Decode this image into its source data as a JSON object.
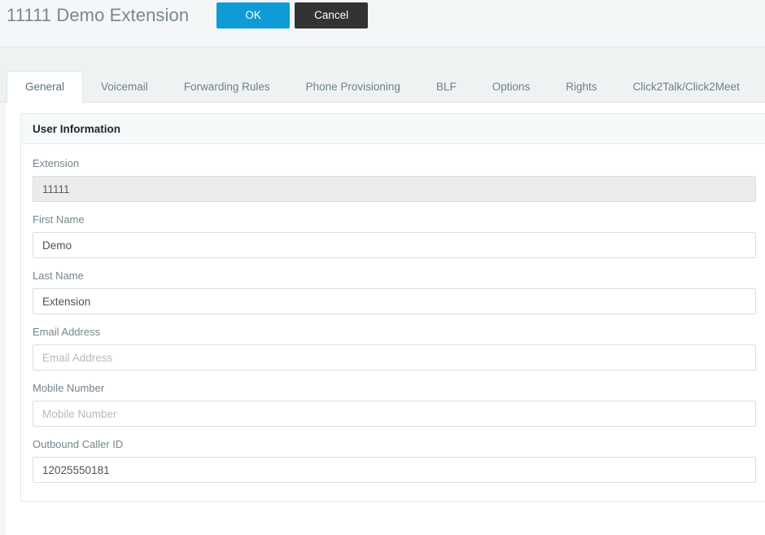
{
  "header": {
    "title": "11111 Demo Extension",
    "ok_label": "OK",
    "cancel_label": "Cancel",
    "ok_color": "#0e9bd6",
    "cancel_color": "#333333"
  },
  "tabs": [
    {
      "label": "General",
      "active": true
    },
    {
      "label": "Voicemail",
      "active": false
    },
    {
      "label": "Forwarding Rules",
      "active": false
    },
    {
      "label": "Phone Provisioning",
      "active": false
    },
    {
      "label": "BLF",
      "active": false
    },
    {
      "label": "Options",
      "active": false
    },
    {
      "label": "Rights",
      "active": false
    },
    {
      "label": "Click2Talk/Click2Meet",
      "active": false
    }
  ],
  "panel": {
    "title": "User Information",
    "fields": [
      {
        "label": "Extension",
        "value": "11111",
        "placeholder": "",
        "disabled": true,
        "name": "extension"
      },
      {
        "label": "First Name",
        "value": "Demo",
        "placeholder": "First Name",
        "disabled": false,
        "name": "first-name"
      },
      {
        "label": "Last Name",
        "value": "Extension",
        "placeholder": "Last Name",
        "disabled": false,
        "name": "last-name"
      },
      {
        "label": "Email Address",
        "value": "",
        "placeholder": "Email Address",
        "disabled": false,
        "name": "email-address"
      },
      {
        "label": "Mobile Number",
        "value": "",
        "placeholder": "Mobile Number",
        "disabled": false,
        "name": "mobile-number"
      },
      {
        "label": "Outbound Caller ID",
        "value": "12025550181",
        "placeholder": "Outbound Caller ID",
        "disabled": false,
        "name": "outbound-caller-id"
      }
    ]
  }
}
